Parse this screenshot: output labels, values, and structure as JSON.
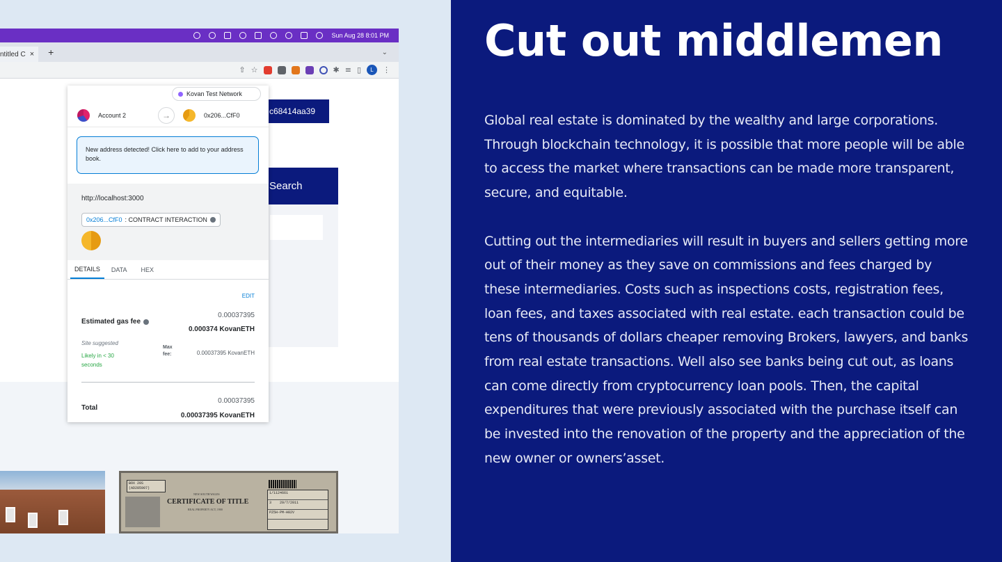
{
  "menubar": {
    "date_time": "Sun Aug 28  8:01 PM",
    "icons": [
      "record-icon",
      "minus-circle-icon",
      "activity-icon",
      "flag-icon",
      "volume-icon",
      "keyboard-icon",
      "wifi-icon",
      "search-icon",
      "control-center-icon",
      "siri-icon"
    ]
  },
  "browser": {
    "tab_title": "ntitled C",
    "tab_close": "×",
    "new_tab": "+",
    "tabs_menu": "⌄",
    "avatar_letter": "L"
  },
  "page": {
    "address_chip": "c68414aa39",
    "search_button": "Search",
    "certificate": {
      "box": "BOX 20S\n(AD285907)",
      "title": "CERTIFICATE OF TITLE",
      "state": "NEW SOUTH WALES",
      "act": "REAL PROPERTY ACT, 1900",
      "folio": "1/1124661",
      "edition": "3",
      "date": "29/7/2011",
      "code": "PZ5H-PM-H02V"
    }
  },
  "metamask": {
    "network": "Kovan Test Network",
    "from_account": "Account 2",
    "to_account": "0x206...CfF0",
    "notice": "New address detected! Click here to add to your address book.",
    "origin": "http://localhost:3000",
    "contract_address": "0x206...CfF0",
    "contract_label": ": CONTRACT INTERACTION",
    "tabs": [
      "DETAILS",
      "DATA",
      "HEX"
    ],
    "edit": "EDIT",
    "gas_fee_secondary": "0.00037395",
    "gas_fee_label": "Estimated gas fee",
    "gas_fee_primary": "0.000374 KovanETH",
    "site_suggested": "Site suggested",
    "likely": "Likely in < 30 seconds",
    "max_fee_label": "Max fee:",
    "max_fee": "0.00037395 KovanETH",
    "total_secondary": "0.00037395",
    "total_label": "Total",
    "total_primary": "0.00037395 KovanETH"
  },
  "slide": {
    "heading": "Cut out middlemen",
    "paragraph1": "Global real estate is dominated by the wealthy and large corporations. Through blockchain technology, it is possible that more people will be able to access the market where transactions can be made more transparent, secure, and equitable.",
    "paragraph2": "Cutting out the intermediaries will result in buyers and sellers getting more out of their money as they save on commissions and fees charged by these intermediaries. Costs such as inspections costs, registration fees, loan fees, and taxes associated with real estate. each transaction could be tens of thousands of dollars cheaper removing Brokers, lawyers, and banks from real estate transactions.  Well also see banks being cut out, as loans can come directly from cryptocurrency loan pools. Then, the capital expenditures that were previously associated with the purchase itself can be invested into the renovation of the property and the appreciation of the new owner or owners’asset.",
    "colors": {
      "panel_bg": "#0b1a7d",
      "page_bg": "#dde8f3",
      "menubar": "#6a2fc4"
    }
  }
}
